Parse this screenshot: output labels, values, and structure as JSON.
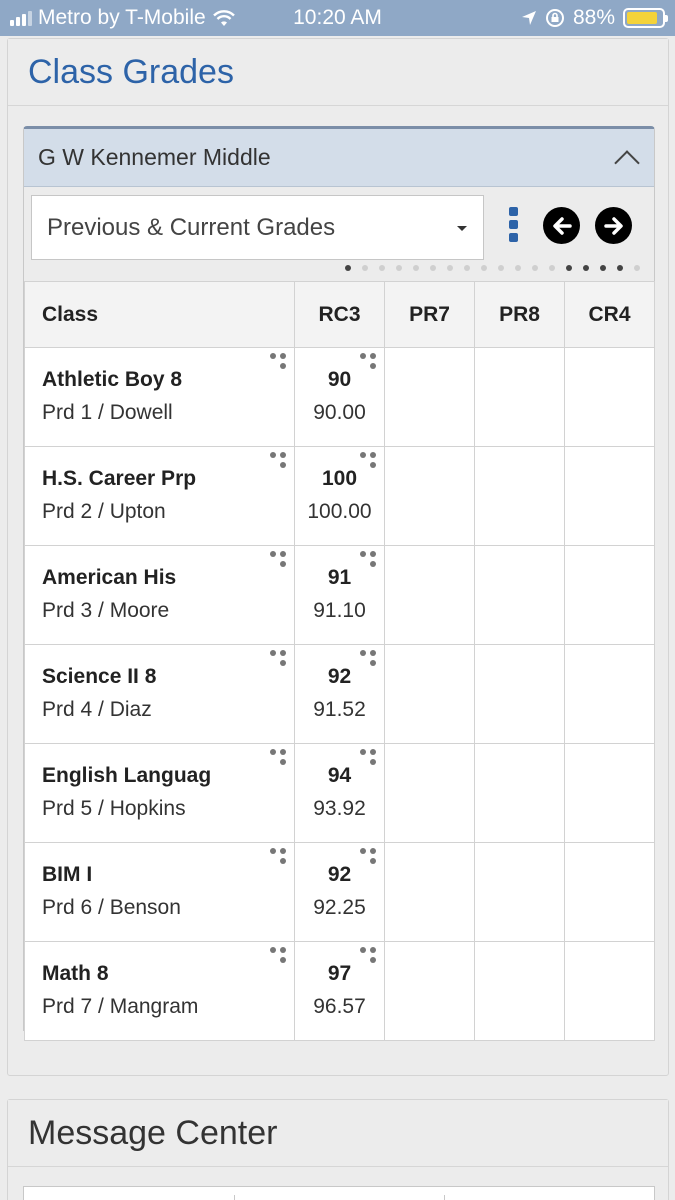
{
  "status_bar": {
    "carrier": "Metro by T-Mobile",
    "time": "10:20 AM",
    "battery": "88%",
    "battery_level": 0.88,
    "icons": [
      "signal-icon",
      "wifi-icon",
      "location-arrow-icon",
      "rotation-lock-icon",
      "battery-icon"
    ]
  },
  "class_grades": {
    "title": "Class Grades",
    "school": "G W Kennemer Middle",
    "dropdown_value": "Previous & Current Grades",
    "columns": [
      "Class",
      "RC3",
      "PR7",
      "PR8",
      "CR4"
    ],
    "pager": {
      "total": 18,
      "active": [
        0,
        13,
        14,
        15,
        16
      ]
    },
    "rows": [
      {
        "name": "Athletic Boy 8",
        "period": "Prd 1 / Dowell",
        "grade": "90",
        "percent": "90.00"
      },
      {
        "name": "H.S. Career Prp",
        "period": "Prd 2 / Upton",
        "grade": "100",
        "percent": "100.00"
      },
      {
        "name": "American His",
        "period": "Prd 3 / Moore",
        "grade": "91",
        "percent": "91.10"
      },
      {
        "name": "Science II 8",
        "period": "Prd 4 / Diaz",
        "grade": "92",
        "percent": "91.52"
      },
      {
        "name": "English Languag",
        "period": "Prd 5 / Hopkins",
        "grade": "94",
        "percent": "93.92"
      },
      {
        "name": "BIM I",
        "period": "Prd 6 / Benson",
        "grade": "92",
        "percent": "92.25"
      },
      {
        "name": "Math 8",
        "period": "Prd 7 / Mangram",
        "grade": "97",
        "percent": "96.57"
      }
    ]
  },
  "message_center": {
    "title": "Message Center"
  },
  "colors": {
    "accent": "#2d63a8",
    "status_bar": "#8fa8c6",
    "school_header": "#d3dde9",
    "battery": "#f4d33a"
  }
}
